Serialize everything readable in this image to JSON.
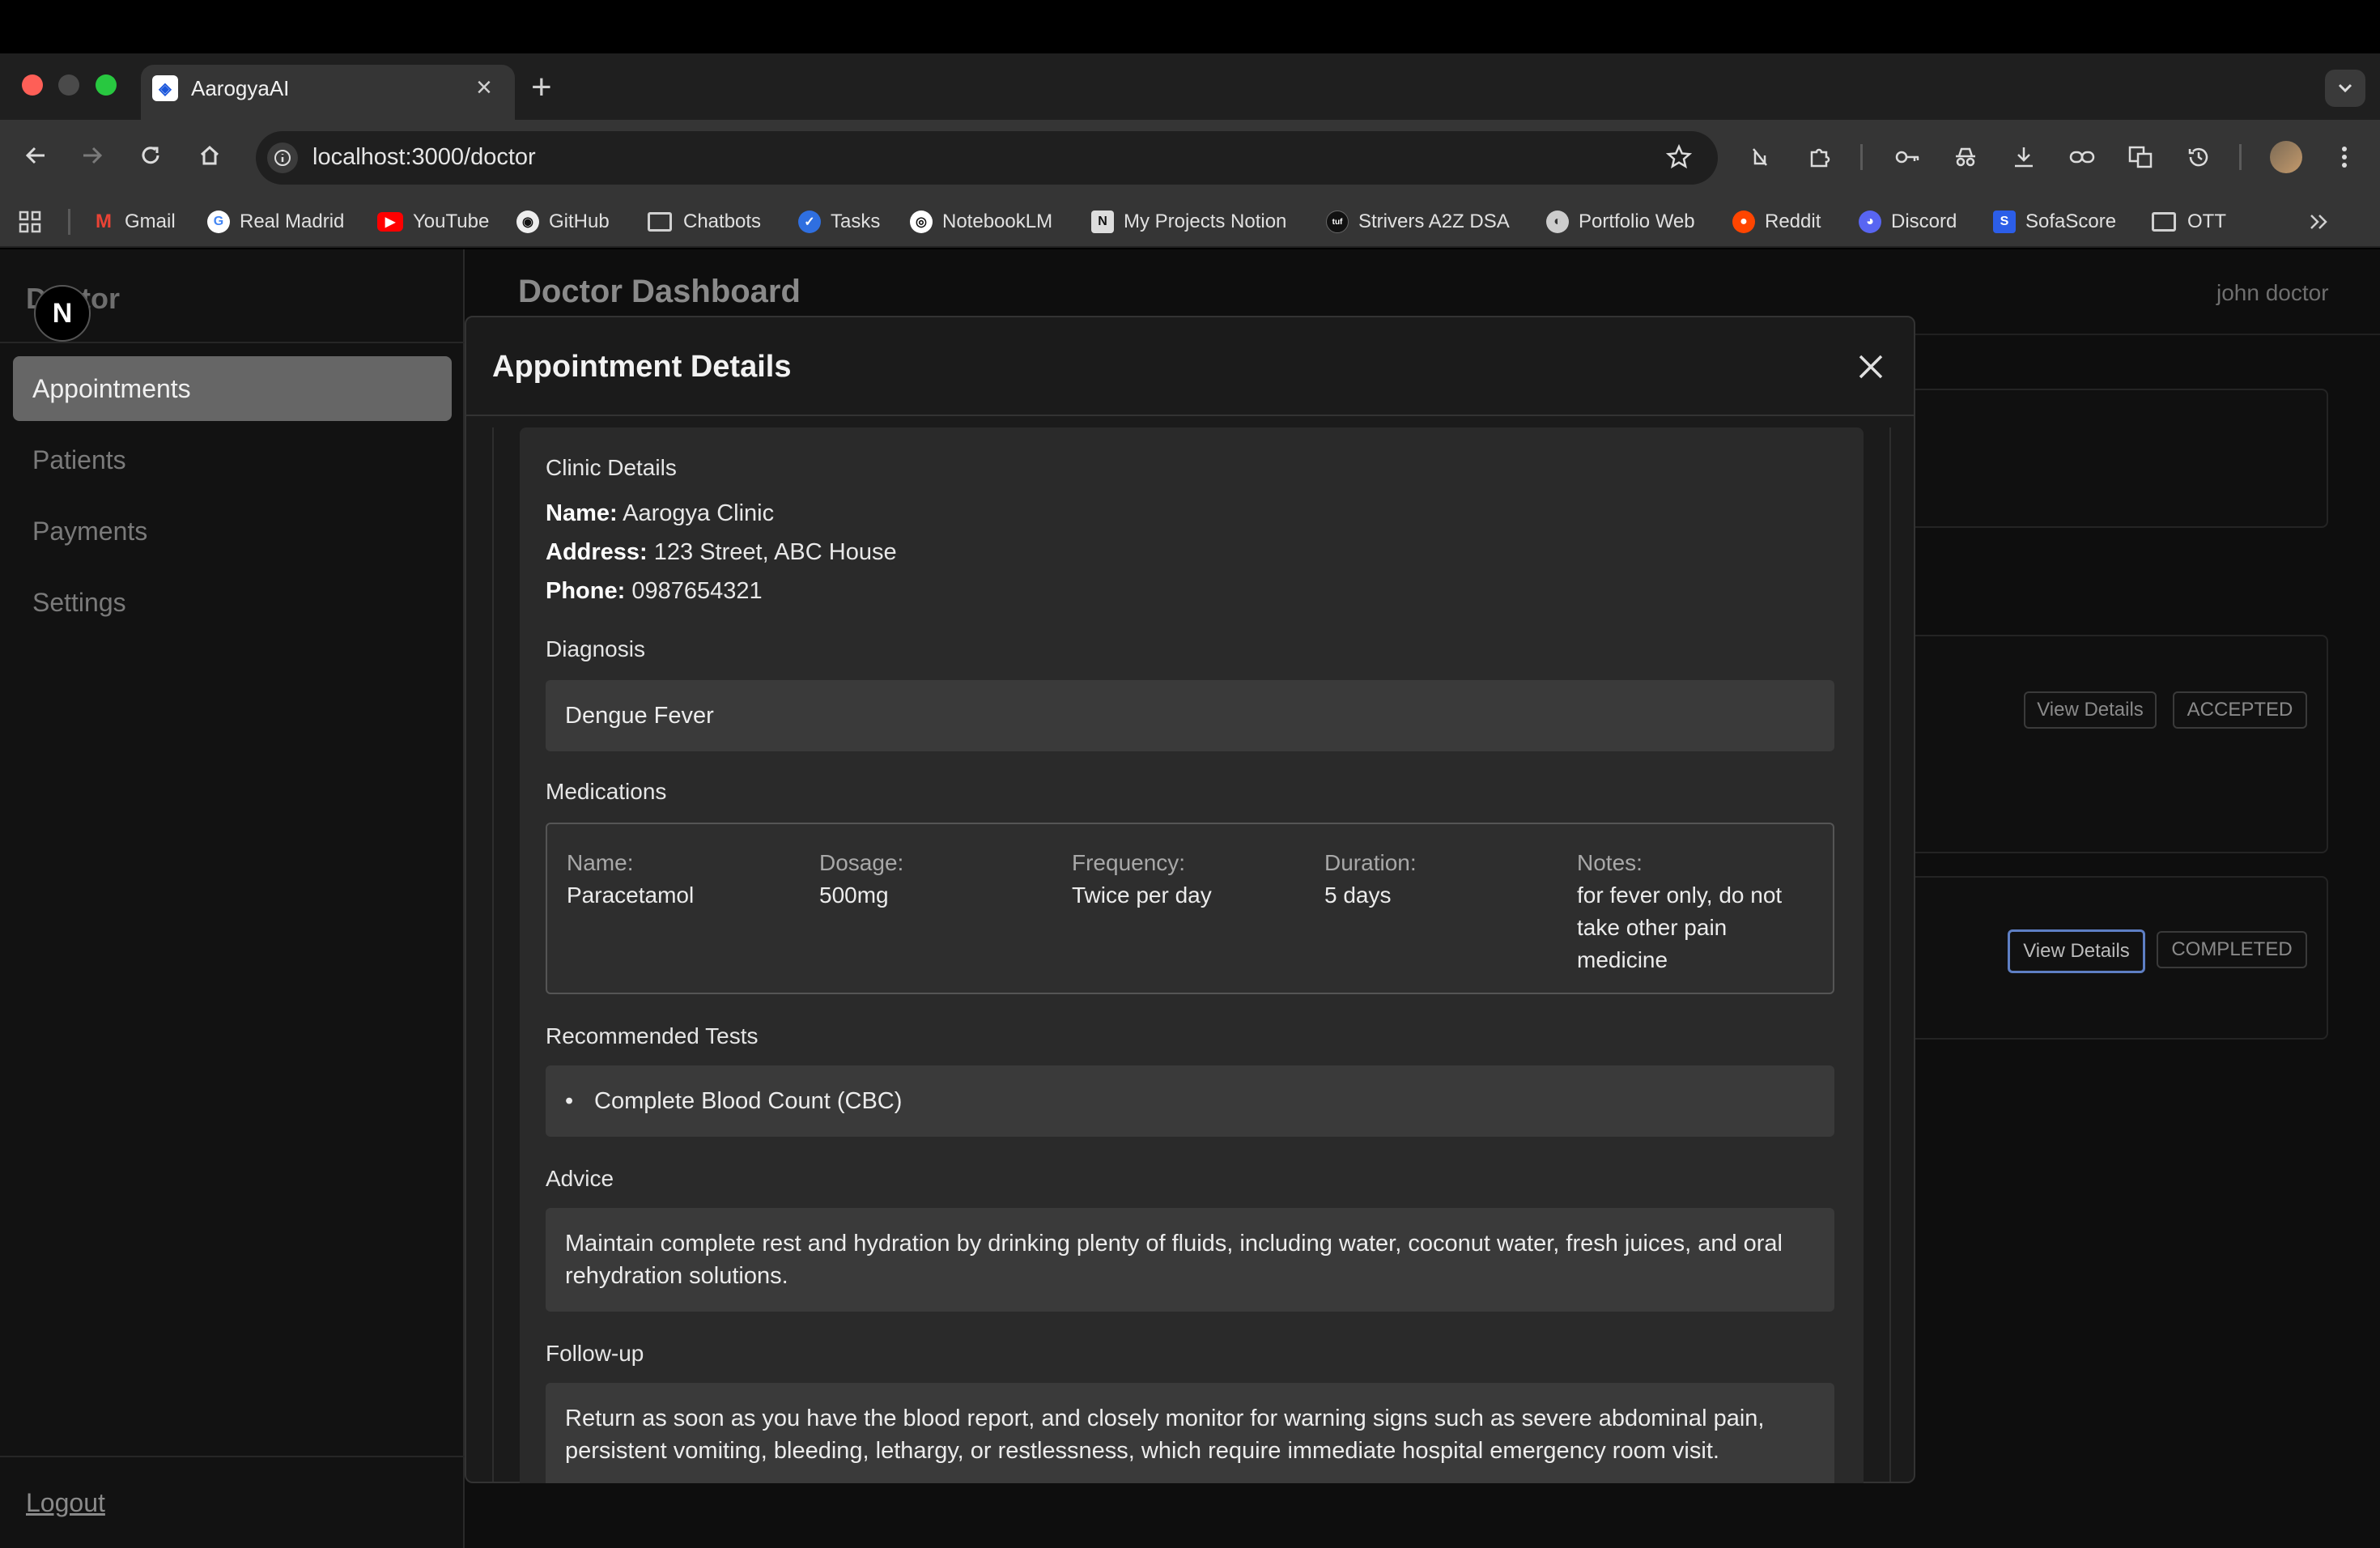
{
  "browser": {
    "tab_title": "AarogyaAI",
    "url": "localhost:3000/doctor",
    "bookmarks": [
      "Gmail",
      "Real Madrid",
      "YouTube",
      "GitHub",
      "Chatbots",
      "Tasks",
      "NotebookLM",
      "My Projects Notion",
      "Strivers A2Z DSA",
      "Portfolio Web",
      "Reddit",
      "Discord",
      "SofaScore",
      "OTT"
    ]
  },
  "sidebar": {
    "brand": "Doctor",
    "badge": "N",
    "items": [
      {
        "label": "Appointments",
        "active": true
      },
      {
        "label": "Patients"
      },
      {
        "label": "Payments"
      },
      {
        "label": "Settings"
      }
    ],
    "logout": "Logout"
  },
  "header": {
    "title": "Doctor Dashboard",
    "user": "john doctor"
  },
  "background_cards": [
    {
      "button": "View Details",
      "status": "ACCEPTED"
    },
    {
      "button": "View Details",
      "status": "COMPLETED"
    }
  ],
  "modal": {
    "title": "Appointment Details",
    "clinic": {
      "section_label": "Clinic Details",
      "name_key": "Name:",
      "name": "Aarogya Clinic",
      "address_key": "Address:",
      "address": "123 Street, ABC House",
      "phone_key": "Phone:",
      "phone": "0987654321"
    },
    "diagnosis": {
      "label": "Diagnosis",
      "value": "Dengue Fever"
    },
    "medications": {
      "label": "Medications",
      "headers": [
        "Name:",
        "Dosage:",
        "Frequency:",
        "Duration:",
        "Notes:"
      ],
      "items": [
        {
          "name": "Paracetamol",
          "dosage": "500mg",
          "frequency": "Twice per day",
          "duration": "5 days",
          "notes": "for fever only, do not take other pain medicine"
        }
      ]
    },
    "tests": {
      "label": "Recommended Tests",
      "items": [
        "Complete Blood Count (CBC)"
      ]
    },
    "advice": {
      "label": "Advice",
      "value": "Maintain complete rest and hydration by drinking plenty of fluids, including water, coconut water, fresh juices, and oral rehydration solutions."
    },
    "followup": {
      "label": "Follow-up",
      "value": "Return as soon as you have the blood report, and closely monitor for warning signs such as severe abdominal pain, persistent vomiting, bleeding, lethargy, or restlessness, which require immediate hospital emergency room visit."
    }
  }
}
